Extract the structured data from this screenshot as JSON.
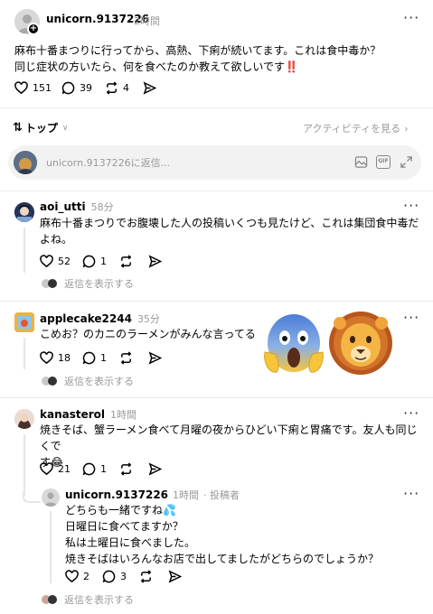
{
  "main_post": {
    "username": "unicorn.9137226",
    "time": "2時間",
    "text_line1": "麻布十番まつりに行ってから、高熱、下痢が続いてます。これは食中毒か？",
    "text_line2": "同じ症状の方いたら、何を食べたのか教えて欲しいです",
    "exclaim": "‼️",
    "likes": "151",
    "comments": "39",
    "reposts": "4"
  },
  "sort_bar": {
    "label": "トップ",
    "activity_link": "アクティビティを見る"
  },
  "reply_box": {
    "placeholder": "unicorn.9137226に返信..."
  },
  "comments": [
    {
      "username": "aoi_utti",
      "time": "58分",
      "line1": "麻布十番まつりでお腹壊した人の投稿いくつも見たけど、これは集団食中毒だ",
      "line2": "よね。",
      "likes": "52",
      "comments": "1",
      "show_replies": "返信を表示する"
    },
    {
      "username": "applecake2244",
      "time": "35分",
      "line1": "こめお？のカニのラーメンがみんな言ってる",
      "likes": "18",
      "comments": "1",
      "show_replies": "返信を表示する",
      "emoji_1": "😱",
      "emoji_2": "🦁"
    },
    {
      "username": "kanasterol",
      "time": "1時間",
      "line1": "焼きそば、蟹ラーメン食べて月曜の夜からひどい下痢と胃痛です。友人も同じくで",
      "line2": "す😂",
      "likes": "21",
      "comments": "1"
    }
  ],
  "author_reply": {
    "username": "unicorn.9137226",
    "time": "1時間",
    "badge": "· 投稿者",
    "line1": "どちらも一緒ですね💦",
    "line2": "日曜日に食べてますか？",
    "line3": "私は土曜日に食べました。",
    "line4": "焼きそばはいろんなお店で出してましたがどちらのでしょうか？",
    "likes": "2",
    "comments": "3",
    "show_replies": "返信を表示する"
  }
}
